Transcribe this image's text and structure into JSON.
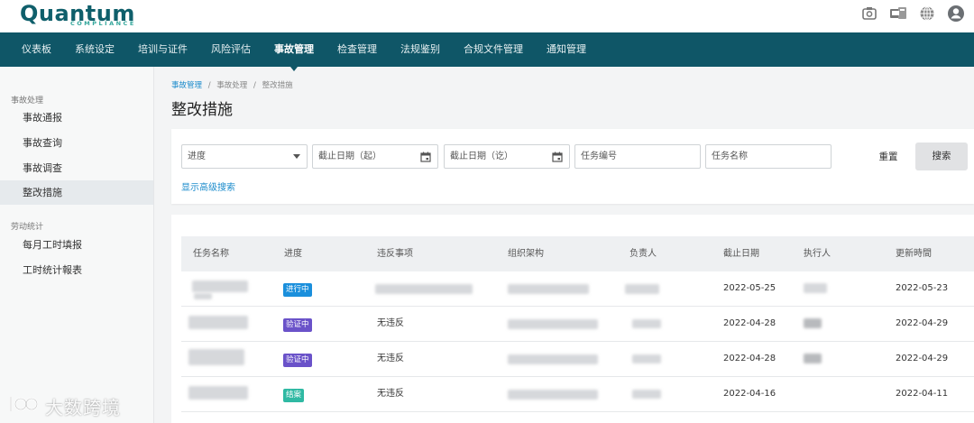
{
  "brand": {
    "name": "Quantum",
    "tagline": "COMPLIANCE"
  },
  "top_icons": [
    "camera-icon",
    "device-icon",
    "globe-icon",
    "user-icon"
  ],
  "nav": {
    "items": [
      {
        "label": "仪表板"
      },
      {
        "label": "系统设定"
      },
      {
        "label": "培训与证件"
      },
      {
        "label": "风险评估"
      },
      {
        "label": "事故管理",
        "active": true
      },
      {
        "label": "检查管理"
      },
      {
        "label": "法规鉴别"
      },
      {
        "label": "合规文件管理"
      },
      {
        "label": "通知管理"
      }
    ]
  },
  "sidebar": {
    "groups": [
      {
        "title": "事故处理",
        "items": [
          {
            "label": "事故通报"
          },
          {
            "label": "事故查询"
          },
          {
            "label": "事故调查"
          },
          {
            "label": "整改措施",
            "active": true
          }
        ]
      },
      {
        "title": "劳动统计",
        "items": [
          {
            "label": "每月工时填报"
          },
          {
            "label": "工时统计報表"
          }
        ]
      }
    ]
  },
  "breadcrumb": {
    "items": [
      "事故管理",
      "事故处理",
      "整改措施"
    ],
    "separator": "/"
  },
  "page_title": "整改措施",
  "filters": {
    "progress_placeholder": "进度",
    "due_from_placeholder": "截止日期（起）",
    "due_to_placeholder": "截止日期（讫）",
    "task_no_placeholder": "任务编号",
    "task_name_placeholder": "任务名称",
    "reset_label": "重置",
    "search_label": "搜索",
    "advanced_link": "显示高级搜索"
  },
  "table": {
    "columns": [
      "任务名称",
      "进度",
      "违反事项",
      "组织架构",
      "负责人",
      "截止日期",
      "执行人",
      "更新時間"
    ],
    "rows": [
      {
        "status": "进行中",
        "status_color": "#1a8fdc",
        "violation": "",
        "due": "2022-05-25",
        "updated": "2022-05-23"
      },
      {
        "status": "验证中",
        "status_color": "#6a52c9",
        "violation": "无违反",
        "due": "2022-04-28",
        "updated": "2022-04-29"
      },
      {
        "status": "验证中",
        "status_color": "#6a52c9",
        "violation": "无违反",
        "due": "2022-04-28",
        "updated": "2022-04-29"
      },
      {
        "status": "结案",
        "status_color": "#2fb9a3",
        "violation": "无违反",
        "due": "2022-04-16",
        "updated": "2022-04-11"
      }
    ]
  },
  "watermark": "大数跨境",
  "colors": {
    "nav_bg": "#0f5667",
    "brand": "#0f5f6b",
    "link": "#1d8ccc"
  }
}
